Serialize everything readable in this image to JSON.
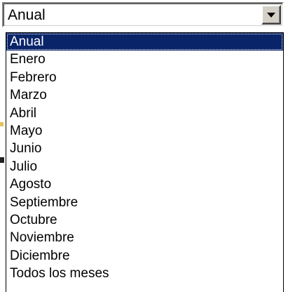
{
  "combo": {
    "value": "Anual",
    "button_icon": "chevron-down-icon"
  },
  "dropdown": {
    "selected_index": 0,
    "options": [
      "Anual",
      "Enero",
      "Febrero",
      "Marzo",
      "Abril",
      "Mayo",
      "Junio",
      "Julio",
      "Agosto",
      "Septiembre",
      "Octubre",
      "Noviembre",
      "Diciembre",
      "Todos los meses"
    ]
  },
  "colors": {
    "selection_bg": "#0a246a",
    "selection_fg": "#ffffff",
    "face": "#d4d0c8"
  }
}
